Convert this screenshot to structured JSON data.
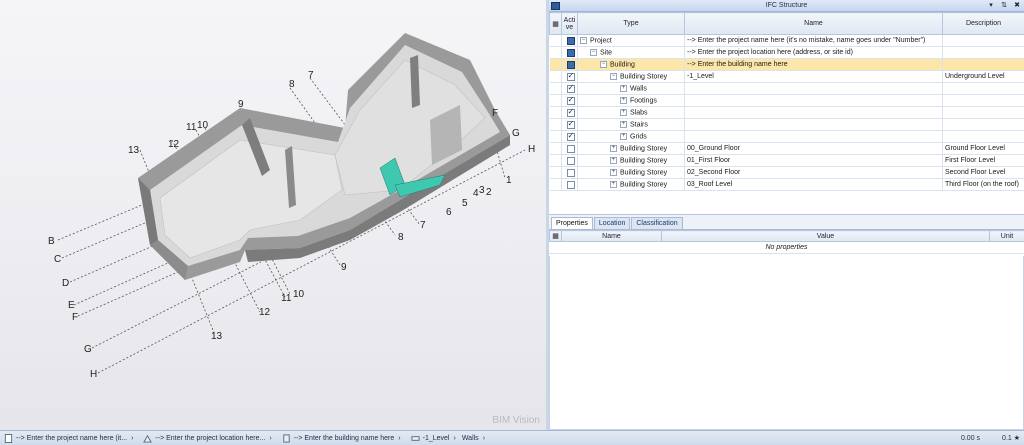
{
  "viewport": {
    "watermark": "BIM Vision",
    "grid_labels": {
      "letters": [
        "B",
        "C",
        "D",
        "E",
        "F",
        "G",
        "H"
      ],
      "right_letters": [
        "F",
        "G",
        "H"
      ],
      "numbers_top": [
        "13",
        "12",
        "11",
        "10",
        "9",
        "8",
        "7",
        "1",
        "2",
        "3",
        "4",
        "5",
        "6",
        "7",
        "8"
      ],
      "numbers_bottom": [
        "9",
        "11",
        "10",
        "12",
        "13"
      ]
    }
  },
  "ifc_panel": {
    "title": "IFC Structure",
    "header_buttons": [
      "▾",
      "⇅",
      "✖"
    ],
    "columns": {
      "icon": "",
      "active": "Acti ve",
      "type": "Type",
      "name": "Name",
      "description": "Description"
    },
    "rows": [
      {
        "level": 0,
        "toggle": "−",
        "checkbox": "filled",
        "type": "Project",
        "name": "--> Enter the project name here (it's no mistake, name goes under \"Number\")",
        "description": ""
      },
      {
        "level": 1,
        "toggle": "−",
        "checkbox": "filled",
        "type": "Site",
        "name": "--> Enter the project location here (address, or site id)",
        "description": ""
      },
      {
        "level": 2,
        "toggle": "−",
        "checkbox": "filled",
        "type": "Building",
        "name": "--> Enter the building name here",
        "description": "",
        "selected": true
      },
      {
        "level": 3,
        "toggle": "−",
        "checkbox": "checked",
        "type": "Building Storey",
        "name": "-1_Level",
        "description": "Underground Level"
      },
      {
        "level": 4,
        "toggle": "+",
        "checkbox": "checked",
        "type": "Walls",
        "name": "",
        "description": ""
      },
      {
        "level": 4,
        "toggle": "+",
        "checkbox": "checked",
        "type": "Footings",
        "name": "",
        "description": ""
      },
      {
        "level": 4,
        "toggle": "+",
        "checkbox": "checked",
        "type": "Slabs",
        "name": "",
        "description": ""
      },
      {
        "level": 4,
        "toggle": "+",
        "checkbox": "checked",
        "type": "Stairs",
        "name": "",
        "description": ""
      },
      {
        "level": 4,
        "toggle": "+",
        "checkbox": "checked",
        "type": "Grids",
        "name": "",
        "description": ""
      },
      {
        "level": 3,
        "toggle": "+",
        "checkbox": "unchecked",
        "type": "Building Storey",
        "name": "00_Ground Floor",
        "description": "Ground Floor Level"
      },
      {
        "level": 3,
        "toggle": "+",
        "checkbox": "unchecked",
        "type": "Building Storey",
        "name": "01_First Floor",
        "description": "First Floor Level"
      },
      {
        "level": 3,
        "toggle": "+",
        "checkbox": "unchecked",
        "type": "Building Storey",
        "name": "02_Second Floor",
        "description": "Second Floor Level"
      },
      {
        "level": 3,
        "toggle": "+",
        "checkbox": "unchecked",
        "type": "Building Storey",
        "name": "03_Roof Level",
        "description": "Third Floor (on the roof)"
      }
    ]
  },
  "props_panel": {
    "tabs": [
      "Properties",
      "Location",
      "Classification"
    ],
    "active_tab": "Properties",
    "columns": {
      "name": "Name",
      "value": "Value",
      "unit": "Unit"
    },
    "empty_text": "No properties"
  },
  "statusbar": {
    "breadcrumbs": [
      {
        "icon": "document-icon",
        "label": "--> Enter the project name here (it..."
      },
      {
        "icon": "site-icon",
        "label": "--> Enter the project location here..."
      },
      {
        "icon": "building-icon",
        "label": "--> Enter the building name here"
      },
      {
        "icon": "storey-icon",
        "label": "-1_Level"
      },
      {
        "icon": "",
        "label": "Walls"
      }
    ],
    "time": "0.00 s",
    "zoom": "0.1 ★"
  },
  "colors": {
    "selection": "#fde7a8",
    "panel_header": "#c6d7ef",
    "stairs": "#3fc7b0"
  }
}
